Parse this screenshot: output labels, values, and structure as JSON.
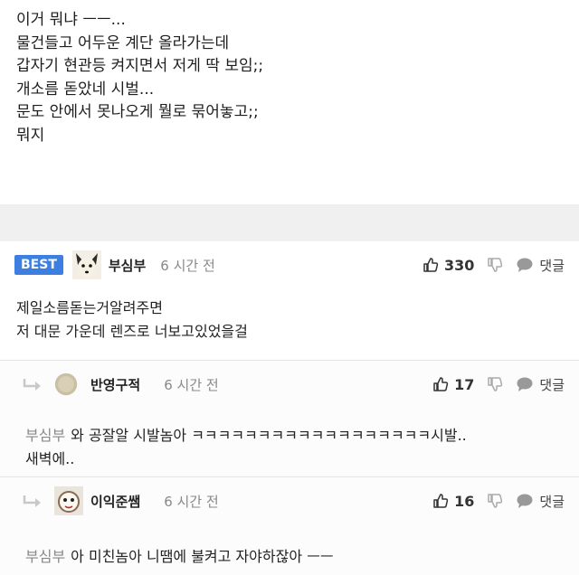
{
  "post": {
    "lines": [
      "이거 뭐냐 ㅡㅡ...",
      "물건들고 어두운 계단 올라가는데",
      "갑자기 현관등 켜지면서 저게 딱 보임;;",
      "개소름 돋았네 시벌...",
      "문도 안에서 못나오게 뭘로 묶어놓고;;",
      "뭐지"
    ]
  },
  "comments": [
    {
      "badge": "BEST",
      "author": "부심부",
      "time": "6 시간 전",
      "likes": "330",
      "reply_label": "댓글",
      "lines": [
        "제일소름돋는거알려주면",
        "저 대문 가운데 렌즈로 너보고있었을걸"
      ]
    },
    {
      "author": "반영구적",
      "time": "6 시간 전",
      "likes": "17",
      "reply_label": "댓글",
      "mention": "부심부",
      "lines": [
        "와 공잘알 시발놈아 ㅋㅋㅋㅋㅋㅋㅋㅋㅋㅋㅋㅋㅋㅋㅋㅋㅋㅋ시발..",
        "새벽에.."
      ]
    },
    {
      "author": "이익준쌤",
      "time": "6 시간 전",
      "likes": "16",
      "reply_label": "댓글",
      "mention": "부심부",
      "lines": [
        "아 미친놈아 니땜에 불켜고 자야하잖아 ㅡㅡ"
      ]
    }
  ],
  "icons": {
    "like": "thumbs-up-icon",
    "dislike": "thumbs-down-icon",
    "reply": "speech-bubble-icon",
    "reply_arrow": "reply-arrow-icon"
  },
  "colors": {
    "best_badge": "#3d7fe0",
    "muted": "#888888"
  }
}
